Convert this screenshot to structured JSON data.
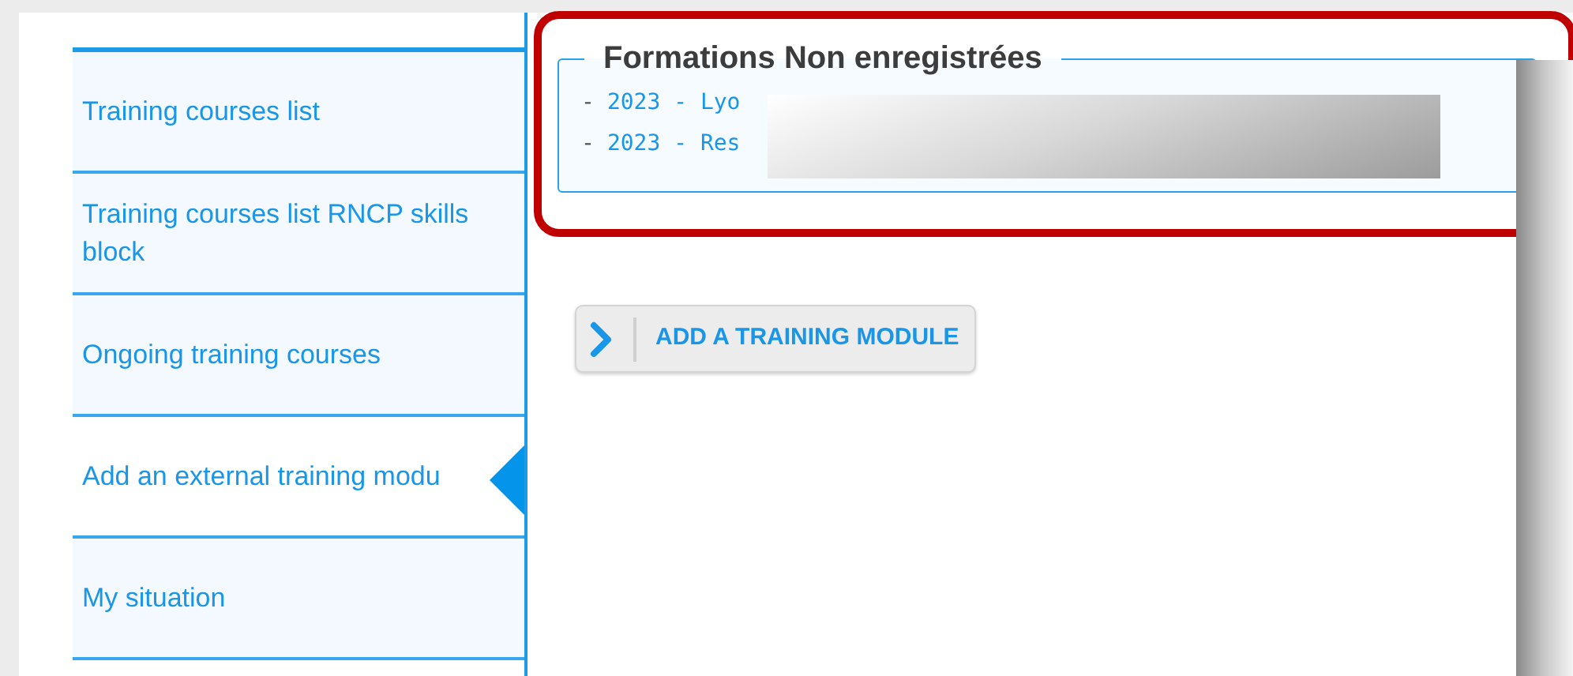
{
  "sidebar": {
    "items": [
      {
        "label": "Training courses list",
        "selected": false
      },
      {
        "label": "Training courses list RNCP skills block",
        "selected": false
      },
      {
        "label": "Ongoing training courses",
        "selected": false
      },
      {
        "label": "Add an external training modu",
        "selected": true
      },
      {
        "label": "My situation",
        "selected": false
      }
    ]
  },
  "unregistered": {
    "legend": "Formations Non enregistrées",
    "items": [
      {
        "bullet": "-",
        "text": "2023 - Lyo"
      },
      {
        "bullet": "-",
        "text": "2023 - Res"
      }
    ]
  },
  "add_button": {
    "label": "ADD A TRAINING MODULE"
  }
}
